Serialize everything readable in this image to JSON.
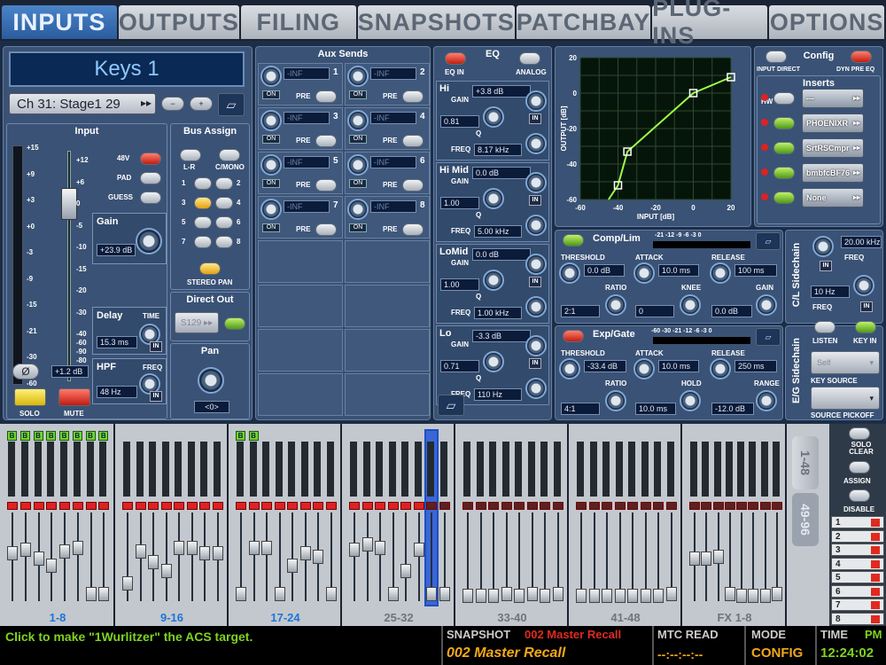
{
  "tabs": [
    "INPUTS",
    "OUTPUTS",
    "FILING",
    "SNAPSHOTS",
    "PATCHBAY",
    "PLUG-INS",
    "OPTIONS"
  ],
  "channel": {
    "name": "Keys 1",
    "source": "Ch 31: Stage1 29",
    "minus": "−",
    "plus": "+"
  },
  "input": {
    "title": "Input",
    "scale_left": [
      "+15",
      "+9",
      "+3",
      "+0",
      "-3",
      "-9",
      "-15",
      "-21",
      "-30",
      "-60"
    ],
    "scale_right": [
      "+12",
      "+6",
      "0",
      "-5",
      "-10",
      "-15",
      "-20",
      "-30",
      "-40",
      "-60",
      "-90",
      "-80"
    ],
    "phantom_label": "48V",
    "pad_label": "PAD",
    "guess_label": "GUESS",
    "gain_label": "Gain",
    "gain_value": "+23.9 dB",
    "delay_label": "Delay",
    "delay_time_label": "TIME",
    "delay_value": "15.3 ms",
    "hpf_label": "HPF",
    "hpf_freq_label": "FREQ",
    "hpf_value": "48 Hz",
    "fader_value": "+1.2 dB",
    "phase_symbol": "Ø",
    "in_label": "IN",
    "solo_label": "SOLO",
    "mute_label": "MUTE"
  },
  "bus_assign": {
    "title": "Bus Assign",
    "lr": "L-R",
    "cmono": "C/MONO",
    "numbers": [
      "1",
      "2",
      "3",
      "4",
      "5",
      "6",
      "7",
      "8"
    ],
    "stereo_pan": "STEREO PAN"
  },
  "direct_out": {
    "title": "Direct Out",
    "value": "S129"
  },
  "pan": {
    "title": "Pan",
    "value": "<0>"
  },
  "aux_sends": {
    "title": "Aux Sends",
    "sends": [
      {
        "num": "1",
        "value": "-INF"
      },
      {
        "num": "2",
        "value": "-INF"
      },
      {
        "num": "3",
        "value": "-INF"
      },
      {
        "num": "4",
        "value": "-INF"
      },
      {
        "num": "5",
        "value": "-INF"
      },
      {
        "num": "6",
        "value": "-INF"
      },
      {
        "num": "7",
        "value": "-INF"
      },
      {
        "num": "8",
        "value": "-INF"
      }
    ],
    "on_label": "ON",
    "pre_label": "PRE"
  },
  "eq": {
    "title": "EQ",
    "eq_in": "EQ IN",
    "analog": "ANALOG",
    "gain_label": "GAIN",
    "freq_label": "FREQ",
    "q_label": "Q",
    "bands": [
      {
        "name": "Hi",
        "gain": "+3.8 dB",
        "q": "0.81",
        "freq": "8.17 kHz"
      },
      {
        "name": "Hi Mid",
        "gain": "0.0 dB",
        "q": "1.00",
        "freq": "5.00 kHz"
      },
      {
        "name": "LoMid",
        "gain": "0.0 dB",
        "q": "1.00",
        "freq": "1.00 kHz"
      },
      {
        "name": "Lo",
        "gain": "-3.3 dB",
        "q": "0.71",
        "freq": "110 Hz"
      }
    ]
  },
  "graph": {
    "ylabel": "OUTPUT [dB]",
    "xlabel": "INPUT [dB]",
    "yticks": [
      "20",
      "0",
      "-20",
      "-40",
      "-60"
    ],
    "xticks": [
      "-60",
      "-40",
      "-20",
      "0",
      "20"
    ],
    "curve": [
      [
        -45,
        -60
      ],
      [
        -40,
        -52
      ],
      [
        -35,
        -33
      ],
      [
        0,
        0
      ],
      [
        20,
        9
      ]
    ]
  },
  "config": {
    "title": "Config",
    "input_direct": "INPUT DIRECT",
    "dyn_pre_eq": "DYN PRE EQ"
  },
  "inserts": {
    "title": "Inserts",
    "hw": "HW",
    "slots": [
      "---",
      "PHOENIXR",
      "SrtRSCmpr",
      "bmbfcBF76",
      "None"
    ]
  },
  "comp": {
    "title": "Comp/Lim",
    "meter_scale": "-21 -12 -9 -6 -3 0",
    "threshold_label": "THRESHOLD",
    "threshold": "0.0 dB",
    "attack_label": "ATTACK",
    "attack": "10.0 ms",
    "release_label": "RELEASE",
    "release": "100 ms",
    "ratio_label": "RATIO",
    "ratio": "2:1",
    "knee_label": "KNEE",
    "knee": "0",
    "gain_label": "GAIN",
    "gain": "0.0 dB"
  },
  "gate": {
    "title": "Exp/Gate",
    "meter_scale": "-60 -30 -21 -12 -6 -3 0",
    "threshold_label": "THRESHOLD",
    "threshold": "-33.4 dB",
    "attack_label": "ATTACK",
    "attack": "10.0 ms",
    "release_label": "RELEASE",
    "release": "250 ms",
    "ratio_label": "RATIO",
    "ratio": "4:1",
    "hold_label": "HOLD",
    "hold": "10.0 ms",
    "range_label": "RANGE",
    "range": "-12.0 dB"
  },
  "cl_sidechain": {
    "title": "C/L Sidechain",
    "freq_value": "20.00 kHz",
    "freq_label": "FREQ",
    "freq2_value": "10 Hz",
    "freq2_label": "FREQ"
  },
  "eg_sidechain": {
    "title": "E/G Sidechain",
    "listen": "LISTEN",
    "key_in": "KEY IN",
    "key_source_value": "Self",
    "key_source_label": "KEY SOURCE",
    "source_pickoff_label": "SOURCE PICKOFF"
  },
  "banks": [
    "1-8",
    "9-16",
    "17-24",
    "25-32",
    "33-40",
    "41-48",
    "FX 1-8"
  ],
  "bank_b_label": "B",
  "side": {
    "tab1": "1-48",
    "tab2": "49-96",
    "solo_clear": "SOLO CLEAR",
    "assign": "ASSIGN",
    "disable": "DISABLE",
    "numbers": [
      "1",
      "2",
      "3",
      "4",
      "5",
      "6",
      "7",
      "8"
    ]
  },
  "status": {
    "message": "Click to make \"1Wurlitzer\" the ACS target.",
    "snapshot_label": "SNAPSHOT",
    "snapshot_top": "002 Master Recall",
    "snapshot_name": "002 Master Recall",
    "mtc_label": "MTC READ",
    "mtc_value": "--:--:--:--",
    "mode_label": "MODE",
    "mode_value": "CONFIG",
    "time_label": "TIME",
    "ampm": "PM",
    "time_value": "12:24:02"
  },
  "colors": {
    "accent_green": "#7ed321",
    "active_tab": "#3a74b8",
    "status_orange": "#f2a71b",
    "mute_red": "#e02a20"
  }
}
